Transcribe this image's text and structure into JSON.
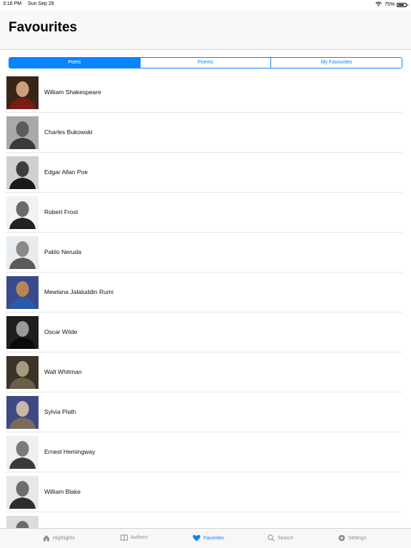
{
  "status_bar": {
    "time": "3:16 PM",
    "date": "Sun Sep 29",
    "battery": "75%"
  },
  "header": {
    "title": "Favourites"
  },
  "segments": [
    {
      "label": "Poets",
      "active": true
    },
    {
      "label": "Poems",
      "active": false
    },
    {
      "label": "My Favourites",
      "active": false
    }
  ],
  "poets": [
    {
      "name": "William Shakespeare",
      "bg": "#3a2418",
      "fg": "#c9a07c",
      "accent": "#7a1c14"
    },
    {
      "name": "Charles Bukowski",
      "bg": "#a9a9a9",
      "fg": "#5c5c5c",
      "accent": "#3a3a3a"
    },
    {
      "name": "Edgar Allan Poe",
      "bg": "#d0d0d0",
      "fg": "#3e3e3e",
      "accent": "#1a1a1a"
    },
    {
      "name": "Robert Frost",
      "bg": "#f2f2f2",
      "fg": "#6a6a6a",
      "accent": "#222222"
    },
    {
      "name": "Pablo Neruda",
      "bg": "#e8ecef",
      "fg": "#8a8a8a",
      "accent": "#5a5a5a"
    },
    {
      "name": "Mewlana Jalaluddin Rumi",
      "bg": "#3b4a8a",
      "fg": "#b5865a",
      "accent": "#2a5aa8"
    },
    {
      "name": "Oscar Wilde",
      "bg": "#1e1e1e",
      "fg": "#9a9a9a",
      "accent": "#0a0a0a"
    },
    {
      "name": "Walt Whitman",
      "bg": "#3a3428",
      "fg": "#a89a80",
      "accent": "#6a5e4a"
    },
    {
      "name": "Sylvia Plath",
      "bg": "#3e4a82",
      "fg": "#c8b8a8",
      "accent": "#7a6a5a"
    },
    {
      "name": "Ernest Hemingway",
      "bg": "#f0f0f0",
      "fg": "#7a7a7a",
      "accent": "#3a3a3a"
    },
    {
      "name": "William Blake",
      "bg": "#e8e8e8",
      "fg": "#6e6e6e",
      "accent": "#2e2e2e"
    },
    {
      "name": "",
      "bg": "#dcdcdc",
      "fg": "#6a6a6a",
      "accent": "#2a2a2a"
    }
  ],
  "tabs": [
    {
      "label": "Highlights",
      "icon": "house-icon",
      "active": false
    },
    {
      "label": "Authors",
      "icon": "book-icon",
      "active": false
    },
    {
      "label": "Favorites",
      "icon": "heart-icon",
      "active": true
    },
    {
      "label": "Search",
      "icon": "search-icon",
      "active": false
    },
    {
      "label": "Settings",
      "icon": "gear-icon",
      "active": false
    }
  ],
  "colors": {
    "accent": "#0a84ff",
    "inactive_tab": "#8e8e93"
  }
}
